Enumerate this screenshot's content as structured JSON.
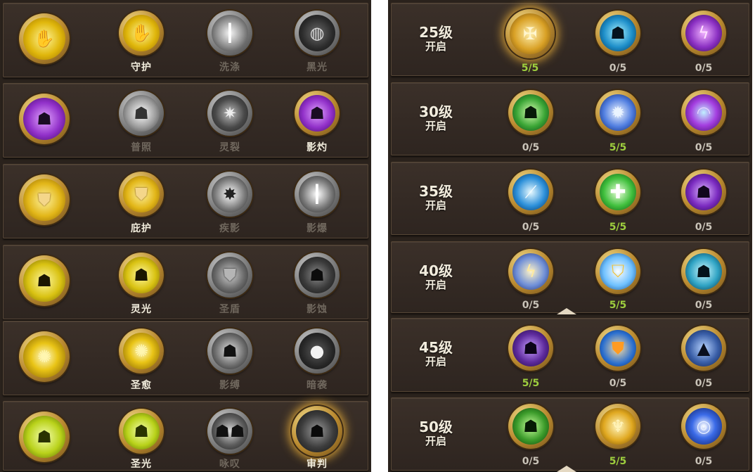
{
  "left_panel": {
    "rows": [
      {
        "skills": [
          {
            "label": "",
            "state": "active",
            "icon": "guard-hand-icon"
          },
          {
            "label": "守护",
            "state": "active",
            "icon": "guard-hand-icon"
          },
          {
            "label": "洗涤",
            "state": "inactive",
            "icon": "light-pillar-icon"
          },
          {
            "label": "黑光",
            "state": "inactive",
            "icon": "dark-orb-icon"
          }
        ]
      },
      {
        "skills": [
          {
            "label": "",
            "state": "active",
            "icon": "shadow-figure-icon"
          },
          {
            "label": "普照",
            "state": "inactive",
            "icon": "radiant-figure-icon"
          },
          {
            "label": "灵裂",
            "state": "inactive",
            "icon": "spirit-crack-icon"
          },
          {
            "label": "影灼",
            "state": "active",
            "icon": "shadow-burn-icon"
          }
        ]
      },
      {
        "skills": [
          {
            "label": "",
            "state": "active",
            "icon": "shield-icon"
          },
          {
            "label": "庇护",
            "state": "active",
            "icon": "shield-icon"
          },
          {
            "label": "疾影",
            "state": "inactive",
            "icon": "swift-shadow-icon"
          },
          {
            "label": "影爆",
            "state": "inactive",
            "icon": "shadow-blast-icon"
          }
        ]
      },
      {
        "skills": [
          {
            "label": "",
            "state": "active",
            "icon": "aura-figure-icon"
          },
          {
            "label": "灵光",
            "state": "active",
            "icon": "aura-figure-icon"
          },
          {
            "label": "圣盾",
            "state": "inactive",
            "icon": "holy-shield-icon"
          },
          {
            "label": "影蚀",
            "state": "inactive",
            "icon": "shadow-erode-icon"
          }
        ]
      },
      {
        "skills": [
          {
            "label": "",
            "state": "active",
            "icon": "healing-light-icon"
          },
          {
            "label": "圣愈",
            "state": "active",
            "icon": "healing-light-icon"
          },
          {
            "label": "影缚",
            "state": "inactive",
            "icon": "shadow-bind-icon"
          },
          {
            "label": "暗袭",
            "state": "inactive",
            "icon": "dark-strike-icon"
          }
        ]
      },
      {
        "skills": [
          {
            "label": "",
            "state": "active",
            "icon": "holy-light-figure-icon"
          },
          {
            "label": "圣光",
            "state": "active",
            "icon": "holy-light-figure-icon"
          },
          {
            "label": "咏叹",
            "state": "inactive",
            "icon": "chant-group-icon"
          },
          {
            "label": "审判",
            "state": "active",
            "icon": "judgement-icon"
          }
        ]
      }
    ]
  },
  "right_panel": {
    "rows": [
      {
        "level": "25级",
        "open": "开启",
        "skills": [
          {
            "count": "5/5",
            "icon": "golden-cross-icon"
          },
          {
            "count": "0/5",
            "icon": "blue-figure-icon"
          },
          {
            "count": "0/5",
            "icon": "purple-lightning-icon"
          }
        ]
      },
      {
        "level": "30级",
        "open": "开启",
        "skills": [
          {
            "count": "0/5",
            "icon": "green-figure-icon"
          },
          {
            "count": "5/5",
            "icon": "blue-burst-icon"
          },
          {
            "count": "0/5",
            "icon": "purple-swirl-icon"
          }
        ]
      },
      {
        "level": "35级",
        "open": "开启",
        "skills": [
          {
            "count": "0/5",
            "icon": "blue-slash-icon"
          },
          {
            "count": "5/5",
            "icon": "green-heal-cross-icon"
          },
          {
            "count": "0/5",
            "icon": "purple-hood-icon"
          }
        ]
      },
      {
        "level": "40级",
        "open": "开启",
        "skills": [
          {
            "count": "0/5",
            "icon": "lightning-strike-icon"
          },
          {
            "count": "5/5",
            "icon": "winged-shield-icon"
          },
          {
            "count": "0/5",
            "icon": "dark-silhouette-icon"
          }
        ]
      },
      {
        "level": "45级",
        "open": "开启",
        "skills": [
          {
            "count": "5/5",
            "icon": "hooded-face-icon"
          },
          {
            "count": "0/5",
            "icon": "orange-shield-icon"
          },
          {
            "count": "0/5",
            "icon": "wizard-hat-icon"
          }
        ]
      },
      {
        "level": "50级",
        "open": "开启",
        "skills": [
          {
            "count": "0/5",
            "icon": "green-warrior-icon"
          },
          {
            "count": "5/5",
            "icon": "golden-angel-icon"
          },
          {
            "count": "0/5",
            "icon": "blue-vortex-icon"
          }
        ]
      }
    ]
  },
  "colors": {
    "count_full": "#9ecf3e",
    "count_empty": "#c9c3b8",
    "label_active": "#f1ecdc",
    "label_inactive": "#6f675d"
  }
}
